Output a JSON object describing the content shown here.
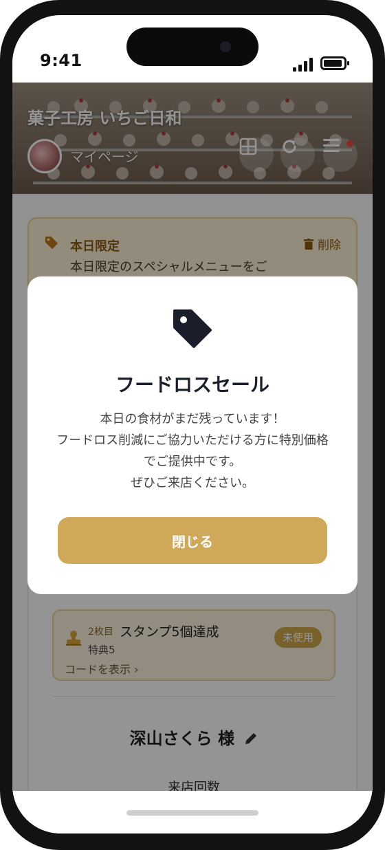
{
  "status_bar": {
    "time": "9:41"
  },
  "header": {
    "shop_name": "菓子工房 いちご日和",
    "mypage_label": "マイページ",
    "icons": [
      "grid-icon",
      "refresh-icon",
      "menu-icon"
    ]
  },
  "notice": {
    "title": "本日限定",
    "delete_label": "削除",
    "text": "本日限定のスペシャルメニューをご"
  },
  "coupon": {
    "count": "2枚目",
    "name": "スタンプ5個達成",
    "perk": "特典5",
    "status": "未使用",
    "code_link": "コードを表示 ›"
  },
  "member": {
    "name": "深山さくら 様",
    "visits_label": "来店回数"
  },
  "modal": {
    "title": "フードロスセール",
    "body": "本日の食材がまだ残っています！\nフードロス削減にご協力いただける方に特別価格でご提供中です。\nぜひご来店ください。",
    "close_label": "閉じる"
  },
  "colors": {
    "accent": "#cfa85a",
    "title_text": "#1b1f2c",
    "notice_bg": "#fdf1d8",
    "badge": "#cfa84a"
  }
}
